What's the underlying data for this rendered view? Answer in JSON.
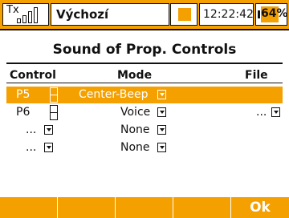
{
  "status_bar": {
    "tx_label": "Tx",
    "tx_sub": "▪▪",
    "model_name": "Výchozí",
    "time": "12:22:42",
    "battery": "64%",
    "battery_level": 0.64,
    "accent_color": "#f4a000"
  },
  "title": "Sound of Prop. Controls",
  "columns": {
    "control": "Control",
    "mode": "Mode",
    "file": "File"
  },
  "rows": [
    {
      "control": "P5",
      "mode": "Center-Beep",
      "file": "",
      "selected": true
    },
    {
      "control": "P6",
      "mode": "Voice",
      "file": "...",
      "selected": false
    },
    {
      "control": "...",
      "mode": "None",
      "file": "",
      "selected": false
    },
    {
      "control": "...",
      "mode": "None",
      "file": "",
      "selected": false
    }
  ],
  "bottom_bar": {
    "ok_label": "Ok"
  }
}
